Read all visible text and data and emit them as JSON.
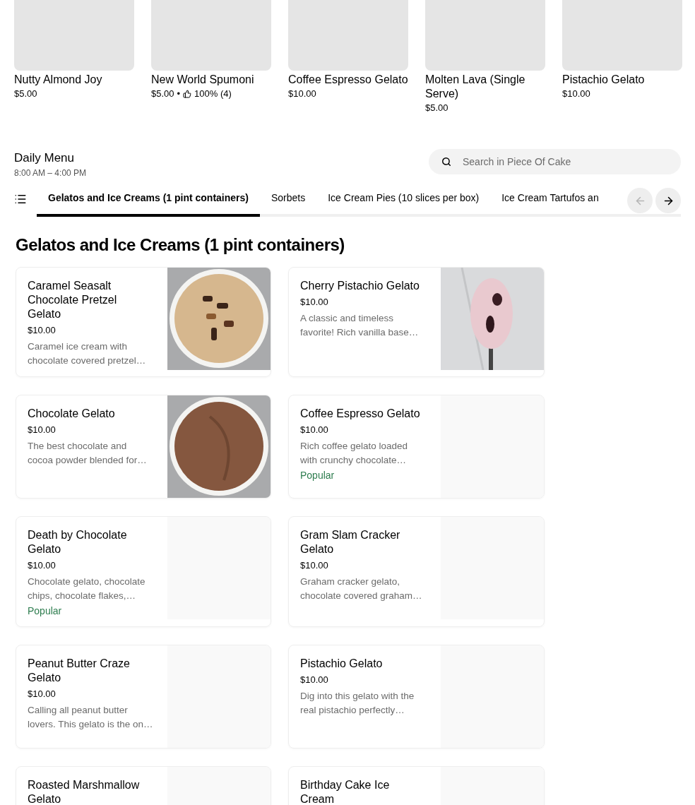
{
  "featured": [
    {
      "name": "Nutty Almond Joy",
      "price": "$5.00"
    },
    {
      "name": "New World Spumoni",
      "price": "$5.00",
      "separator": "•",
      "rating": "100% (4)"
    },
    {
      "name": "Coffee Espresso Gelato",
      "price": "$10.00"
    },
    {
      "name": "Molten Lava (Single Serve)",
      "price": "$5.00"
    },
    {
      "name": "Pistachio Gelato",
      "price": "$10.00"
    }
  ],
  "menu": {
    "title": "Daily Menu",
    "hours": "8:00 AM – 4:00 PM"
  },
  "search": {
    "placeholder": "Search in Piece Of Cake"
  },
  "tabs": [
    {
      "label": "Gelatos and Ice Creams (1 pint containers)",
      "selected": true
    },
    {
      "label": "Sorbets",
      "selected": false
    },
    {
      "label": "Ice Cream Pies (10 slices per box)",
      "selected": false
    },
    {
      "label": "Ice Cream Tartufos an",
      "selected": false
    }
  ],
  "scroll_buttons": [
    {
      "kind": "back",
      "disabled": true
    },
    {
      "kind": "forward",
      "disabled": false
    }
  ],
  "section_title": "Gelatos and Ice Creams (1 pint containers)",
  "items": [
    {
      "name": "Caramel Seasalt Chocolate Pretzel Gelato",
      "price": "$10.00",
      "description": [
        "Caramel ice cream with",
        "chocolate covered pretzel…"
      ]
    },
    {
      "name": "Cherry Pistachio Gelato",
      "price": "$10.00",
      "description": [
        "A classic and timeless",
        "favorite! Rich vanilla base…"
      ]
    },
    {
      "name": "Chocolate Gelato",
      "price": "$10.00",
      "description": [
        "The best chocolate and",
        "cocoa powder blended for…"
      ]
    },
    {
      "kind": "placeholder",
      "name": "Coffee Espresso Gelato",
      "price": "$10.00",
      "description": [
        "Rich coffee gelato loaded",
        "with crunchy chocolate…"
      ],
      "badge": "Popular"
    },
    {
      "kind": "placeholder",
      "name": "Death by Chocolate Gelato",
      "price": "$10.00",
      "description": [
        "Chocolate gelato, chocolate",
        "chips, chocolate flakes,…"
      ],
      "badge": "Popular"
    },
    {
      "kind": "placeholder",
      "name": "Gram Slam Cracker Gelato",
      "price": "$10.00",
      "description": [
        "Graham cracker gelato,",
        "chocolate covered graham…"
      ]
    },
    {
      "kind": "placeholder",
      "name": "Peanut Butter Craze Gelato",
      "price": "$10.00",
      "description": [
        "Calling all peanut butter",
        "lovers. This gelato is the on…"
      ]
    },
    {
      "kind": "placeholder",
      "name": "Pistachio Gelato",
      "price": "$10.00",
      "description": [
        "Dig into this gelato with the",
        "real pistachio perfectly…"
      ]
    },
    {
      "kind": "placeholder",
      "name": "Roasted Marshmallow Gelato"
    },
    {
      "kind": "placeholder",
      "name": "Birthday Cake Ice Cream"
    }
  ]
}
